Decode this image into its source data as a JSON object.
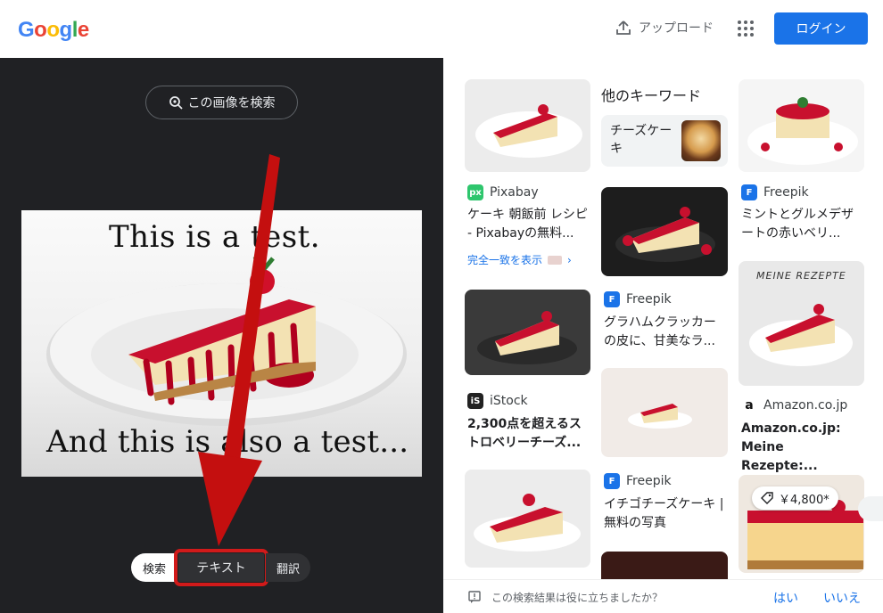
{
  "header": {
    "logo_letters": [
      "G",
      "o",
      "o",
      "g",
      "l",
      "e"
    ],
    "logo_colors": [
      "#4285F4",
      "#EA4335",
      "#FBBC05",
      "#4285F4",
      "#34A853",
      "#EA4335"
    ],
    "upload_label": "アップロード",
    "login_label": "ログイン"
  },
  "left": {
    "search_image_label": "この画像を検索",
    "image_text_line1": "This is a test.",
    "image_text_line2": "And this is also a test...",
    "modes": {
      "search": "検索",
      "text": "テキスト",
      "translate": "翻訳"
    }
  },
  "results": {
    "col1": [
      {
        "source": "Pixabay",
        "source_icon": "px",
        "source_color": "#2ec66d",
        "title": "ケーキ 朝飯前 レシピ - Pixabayの無料...",
        "exact_match": "完全一致を表示"
      },
      {
        "source": "iStock",
        "source_icon": "iS",
        "source_color": "#222222",
        "title": "2,300点を超えるストロベリーチーズ..."
      }
    ],
    "col2": {
      "keywords_title": "他のキーワード",
      "keyword": "チーズケーキ",
      "items": [
        {
          "source": "Freepik",
          "title": "グラハムクラッカーの皮に、甘美なラ..."
        },
        {
          "source": "Freepik",
          "title": "イチゴチーズケーキ | 無料の写真"
        }
      ]
    },
    "col3": [
      {
        "source": "Freepik",
        "title": "ミントとグルメデザートの赤いベリ..."
      },
      {
        "source": "Amazon.co.jp",
        "image_text": "MEINE REZEPTE",
        "title": "Amazon.co.jp: Meine Rezepte:..."
      },
      {
        "price": "￥4,800*"
      }
    ],
    "source_icon_color": "#1a73e8"
  },
  "feedback": {
    "question": "この検索結果は役に立ちましたか？",
    "yes": "はい",
    "no": "いいえ"
  }
}
